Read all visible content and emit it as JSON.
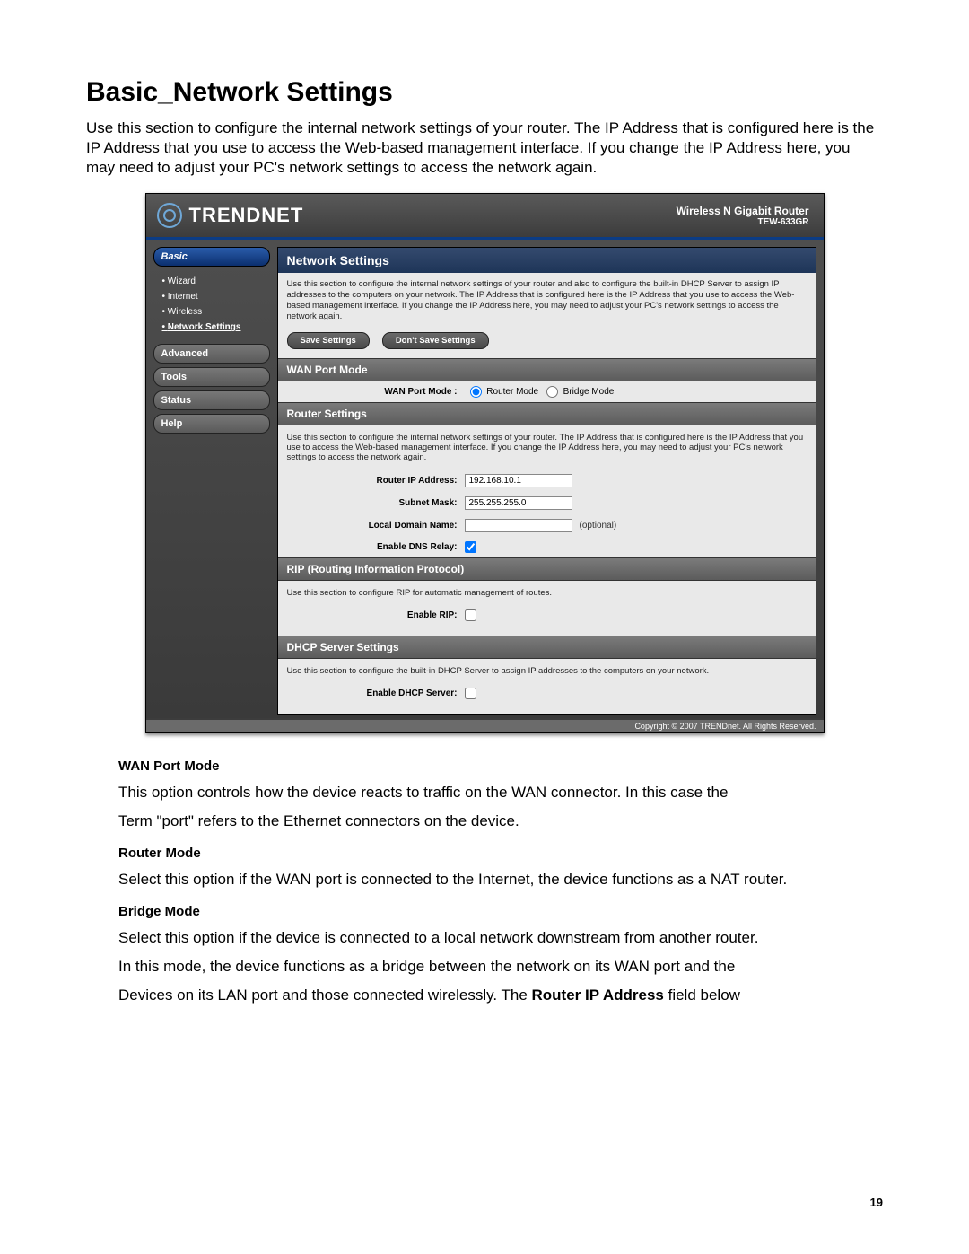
{
  "doc": {
    "heading": "Basic_Network Settings",
    "intro": "Use this section to configure the internal network settings of your router. The IP Address that is configured here is the IP Address that you use to access the Web-based management interface. If you change the IP Address here, you may need to adjust your PC's network settings to access the network again.",
    "page_number": "19"
  },
  "router": {
    "brand": "TRENDNET",
    "model_line1": "Wireless N Gigabit Router",
    "model_line2": "TEW-633GR",
    "sidebar": {
      "basic": "Basic",
      "items": [
        "Wizard",
        "Internet",
        "Wireless",
        "Network Settings"
      ],
      "advanced": "Advanced",
      "tools": "Tools",
      "status": "Status",
      "help": "Help"
    },
    "content": {
      "title": "Network Settings",
      "top_desc": "Use this section to configure the internal network settings of your router and also to configure the built-in DHCP Server to assign IP addresses to the computers on your network. The IP Address that is configured here is the IP Address that you use to access the Web-based management interface. If you change the IP Address here, you may need to adjust your PC's network settings to access the network again.",
      "save_btn": "Save Settings",
      "dont_save_btn": "Don't Save Settings",
      "wan_port_mode": {
        "title": "WAN Port Mode",
        "label": "WAN Port Mode :",
        "opt1": "Router Mode",
        "opt2": "Bridge Mode"
      },
      "router_settings": {
        "title": "Router Settings",
        "desc": "Use this section to configure the internal network settings of your router. The IP Address that is configured here is the IP Address that you use to access the Web-based management interface. If you change the IP Address here, you may need to adjust your PC's network settings to access the network again.",
        "ip_label": "Router IP Address:",
        "ip_value": "192.168.10.1",
        "mask_label": "Subnet Mask:",
        "mask_value": "255.255.255.0",
        "domain_label": "Local Domain Name:",
        "domain_value": "",
        "domain_note": "(optional)",
        "dns_label": "Enable DNS Relay:"
      },
      "rip": {
        "title": "RIP (Routing Information Protocol)",
        "desc": "Use this section to configure RIP for automatic management of routes.",
        "label": "Enable RIP:"
      },
      "dhcp": {
        "title": "DHCP Server Settings",
        "desc": "Use this section to configure the built-in DHCP Server to assign IP addresses to the computers on your network.",
        "label": "Enable DHCP Server:"
      }
    },
    "footer": "Copyright © 2007 TRENDnet. All Rights Reserved."
  },
  "body": {
    "wan_title": "WAN Port Mode",
    "wan_p1": "This option controls how the device reacts to traffic on the WAN connector. In this case the",
    "wan_p2": "Term \"port\" refers to the Ethernet connectors on the device.",
    "router_title": "Router Mode",
    "router_p": "Select this option if the WAN port is connected to the Internet, the device functions as a NAT router.",
    "bridge_title": "Bridge Mode",
    "bridge_p1": "Select this option if the device is connected to a local network downstream from another router.",
    "bridge_p2": "In this mode, the device functions as a bridge between the network on its WAN port and the",
    "bridge_p3_a": "Devices on its LAN port and those connected wirelessly. The ",
    "bridge_p3_b": "Router IP Address",
    "bridge_p3_c": " field below"
  }
}
